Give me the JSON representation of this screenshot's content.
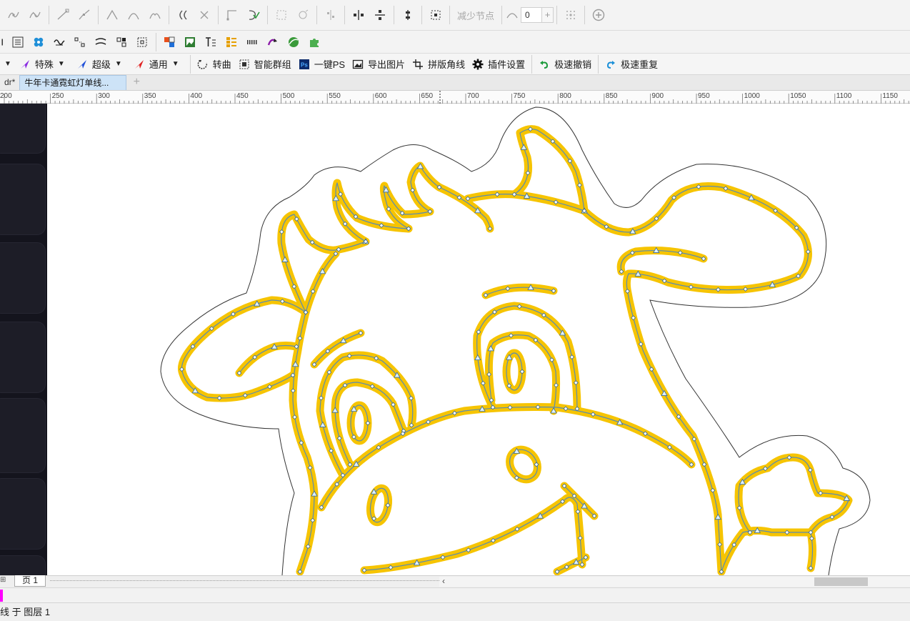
{
  "node_toolbar": {
    "reduce_nodes_label": "减少节点",
    "smoothness_value": "0",
    "spin_plus": "+"
  },
  "plugin_menu": {
    "items": [
      {
        "label": "特殊",
        "icon": "purple-arrow-icon"
      },
      {
        "label": "超级",
        "icon": "blue-arrow-icon"
      },
      {
        "label": "通用",
        "icon": "red-arrow-icon"
      },
      {
        "label": "转曲",
        "icon": "convert-curve-icon"
      },
      {
        "label": "智能群组",
        "icon": "smart-group-icon"
      },
      {
        "label": "一键PS",
        "icon": "photoshop-icon"
      },
      {
        "label": "导出图片",
        "icon": "export-image-icon"
      },
      {
        "label": "拼版角线",
        "icon": "crop-marks-icon"
      },
      {
        "label": "插件设置",
        "icon": "gear-icon"
      },
      {
        "label": "极速撤销",
        "icon": "undo-icon"
      },
      {
        "label": "极速重复",
        "icon": "redo-icon"
      }
    ],
    "colors": {
      "purple": "#8a2be2",
      "blue": "#1f4fd8",
      "red": "#e02020",
      "undo_green": "#1a9a3a",
      "redo_blue": "#1a8fd8"
    }
  },
  "doc_tabs": {
    "prev_tab": "dr*",
    "active_tab": "牛年卡通霓虹灯单线...",
    "add_symbol": "+"
  },
  "ruler": {
    "labels": [
      "200",
      "250",
      "300",
      "350",
      "400",
      "450",
      "500",
      "550",
      "600",
      "650",
      "700",
      "750",
      "800",
      "850",
      "900",
      "950",
      "1000",
      "1050",
      "1100",
      "1150"
    ]
  },
  "page_bar": {
    "page_tab": "页 1"
  },
  "status_bar": {
    "text": "线 于 图层 1"
  },
  "artwork": {
    "stroke_color": "#f6c400",
    "centerline_color": "#5a8bb3",
    "outline_color": "#333333"
  }
}
